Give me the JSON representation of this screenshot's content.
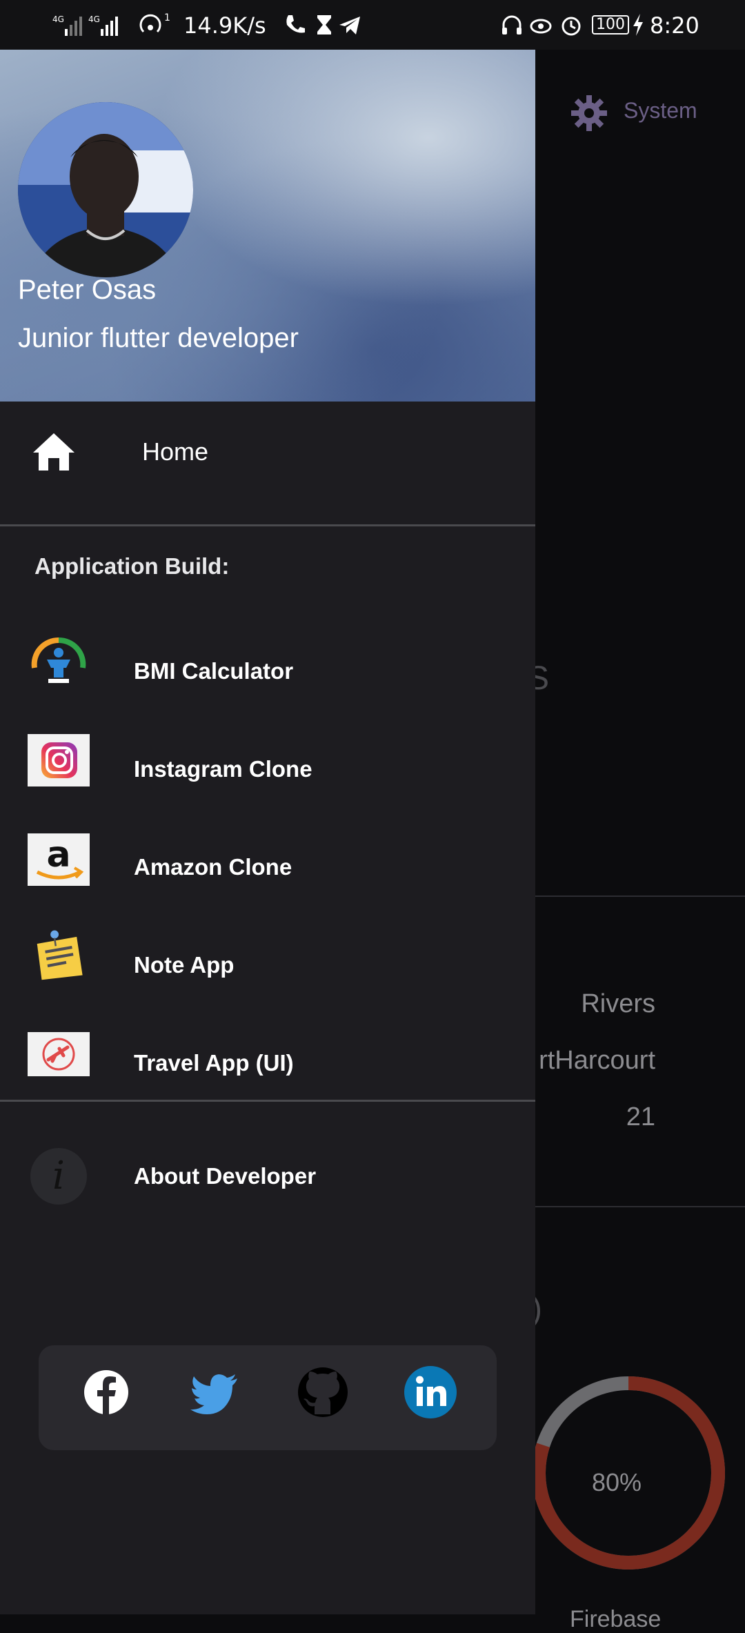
{
  "status_bar": {
    "network_speed": "14.9K/s",
    "battery": "100",
    "time": "8:20"
  },
  "background_app": {
    "theme_label": "System",
    "state": "Rivers",
    "city": "rtHarcourt",
    "age": "21",
    "progress_value": 0.8,
    "progress_label": "80%",
    "progress_caption": "Firebase",
    "colors": {
      "ring_fill": "#7a2a1e",
      "ring_track": "#6b6b6e"
    }
  },
  "drawer": {
    "header": {
      "name": "Peter Osas",
      "role": "Junior flutter developer"
    },
    "home": {
      "label": "Home",
      "icon": "home-icon"
    },
    "section_title": "Application Build:",
    "apps": [
      {
        "label": "BMI Calculator",
        "icon": "bmi-calculator-icon"
      },
      {
        "label": "Instagram Clone",
        "icon": "instagram-icon"
      },
      {
        "label": "Amazon Clone",
        "icon": "amazon-icon"
      },
      {
        "label": "Note App",
        "icon": "sticky-note-icon"
      },
      {
        "label": "Travel App (UI)",
        "icon": "travel-plane-icon"
      }
    ],
    "about": {
      "label": "About Developer",
      "icon": "info-icon"
    },
    "social": [
      {
        "icon": "facebook-icon"
      },
      {
        "icon": "twitter-icon"
      },
      {
        "icon": "github-icon"
      },
      {
        "icon": "linkedin-icon"
      }
    ],
    "colors": {
      "drawer_bg": "#1d1c20",
      "divider": "#4a4a4e",
      "twitter": "#4a9fe6",
      "linkedin": "#0a78b5"
    }
  }
}
